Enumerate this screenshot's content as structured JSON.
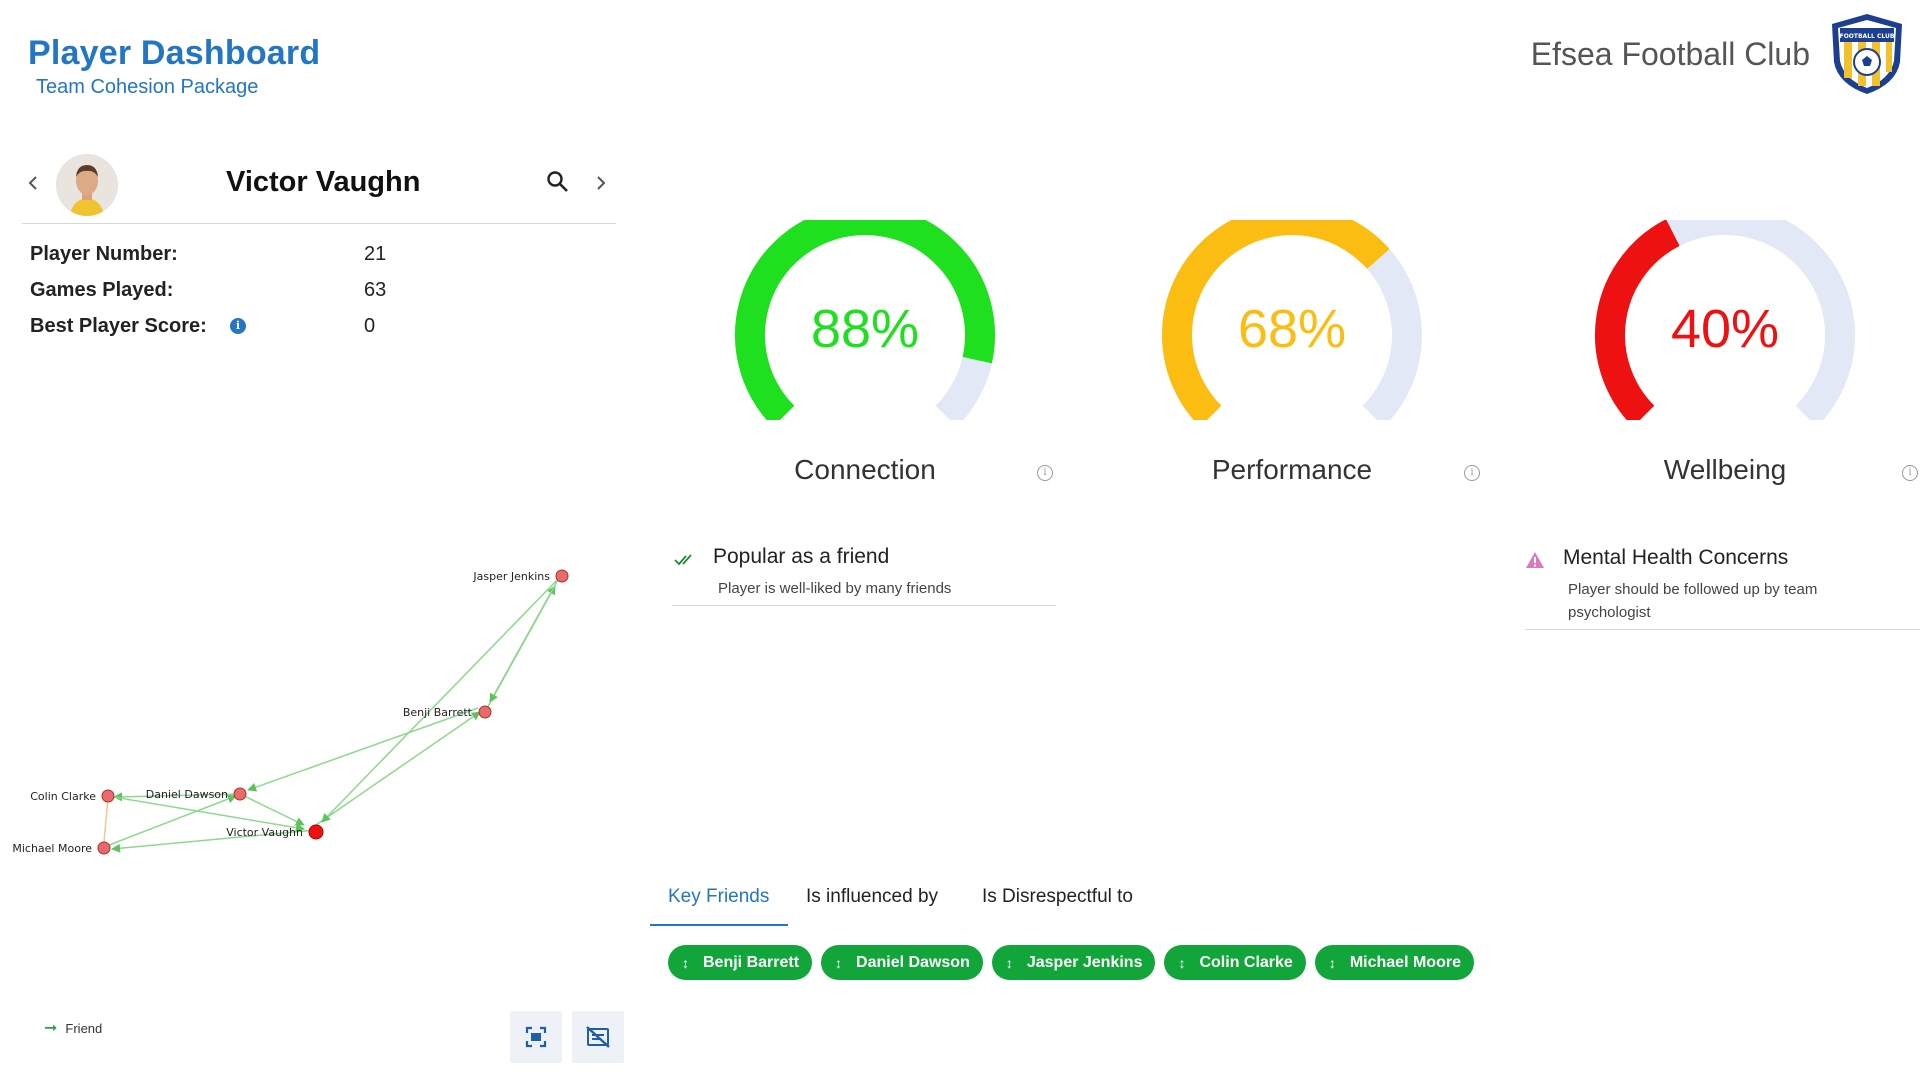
{
  "header": {
    "title": "Player Dashboard",
    "subtitle": "Team Cohesion Package",
    "club_name": "Efsea Football Club",
    "crest_text": "FOOTBALL CLUB"
  },
  "player": {
    "name": "Victor Vaughn",
    "stats": [
      {
        "label": "Player Number:",
        "value": "21"
      },
      {
        "label": "Games Played:",
        "value": "63"
      },
      {
        "label": "Best Player Score:",
        "value": "0"
      }
    ]
  },
  "icons": {
    "prev": "chevron-left-icon",
    "next": "chevron-right-icon",
    "search": "search-icon",
    "info": "info-icon",
    "fit": "fit-screen-icon",
    "hide_labels": "hide-labels-icon",
    "check": "double-check-icon",
    "warning": "warning-icon",
    "chip": "vertical-arrows-icon"
  },
  "graph": {
    "nodes": [
      "Jasper Jenkins",
      "Benji Barrett",
      "Colin Clarke",
      "Daniel Dawson",
      "Victor Vaughn",
      "Michael Moore"
    ],
    "legend": "Friend"
  },
  "gauges": [
    {
      "label": "Connection",
      "value": "88%",
      "fraction": 0.88,
      "color": "#1ee01e"
    },
    {
      "label": "Performance",
      "value": "68%",
      "fraction": 0.68,
      "color": "#fbbd12"
    },
    {
      "label": "Wellbeing",
      "value": "40%",
      "fraction": 0.4,
      "color": "#ee1111"
    }
  ],
  "insights": [
    {
      "title": "Popular as a friend",
      "desc": "Player is well-liked by many friends"
    },
    {
      "title": "Mental Health Concerns",
      "desc": "Player should be followed up by team psychologist"
    }
  ],
  "tabs": [
    "Key Friends",
    "Is influenced by",
    "Is Disrespectful to"
  ],
  "chips": [
    "Benji Barrett",
    "Daniel Dawson",
    "Jasper Jenkins",
    "Colin Clarke",
    "Michael Moore"
  ],
  "colors": {
    "accent": "#2376c4",
    "chip": "#12a63a",
    "edge": "#7fd47f",
    "node": "#e96a6a",
    "track": "#e2e8f5"
  }
}
